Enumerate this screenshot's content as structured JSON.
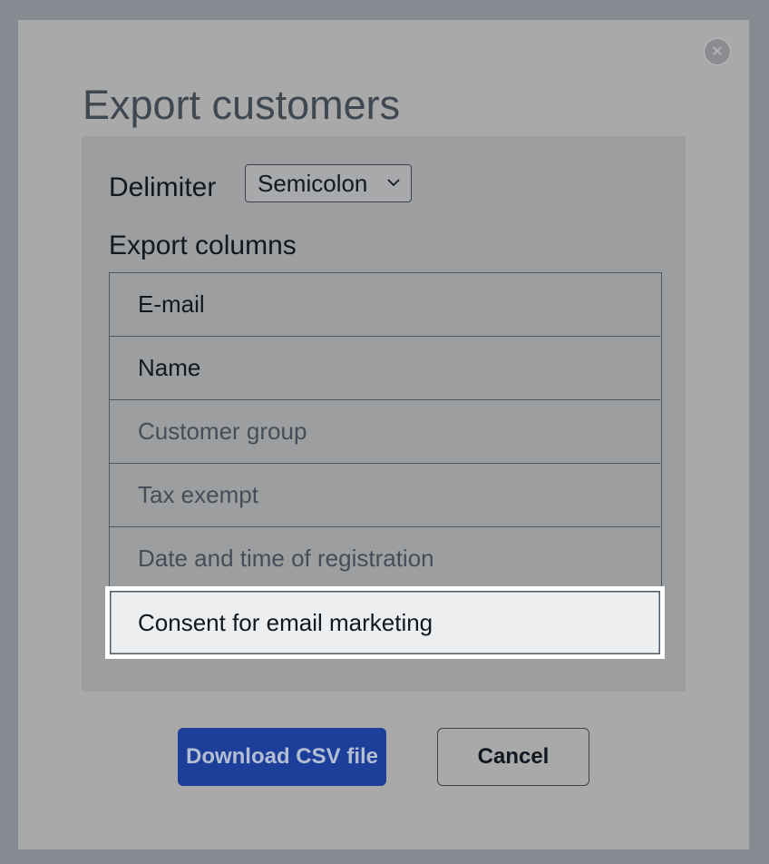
{
  "dialog": {
    "title": "Export customers",
    "close_icon": "close-icon"
  },
  "delimiter": {
    "label": "Delimiter",
    "selected": "Semicolon"
  },
  "export_columns": {
    "label": "Export columns",
    "items": [
      {
        "label": "E-mail",
        "selected": true
      },
      {
        "label": "Name",
        "selected": true
      },
      {
        "label": "Customer group",
        "selected": false
      },
      {
        "label": "Tax exempt",
        "selected": false
      },
      {
        "label": "Date and time of registration",
        "selected": false
      },
      {
        "label": "Consent for email marketing",
        "selected": true,
        "highlighted": true
      }
    ]
  },
  "buttons": {
    "download": "Download CSV file",
    "cancel": "Cancel"
  },
  "colors": {
    "primary_button": "#1d3f9a",
    "overlay": "#858b91",
    "highlight_row": "#eceef0"
  }
}
